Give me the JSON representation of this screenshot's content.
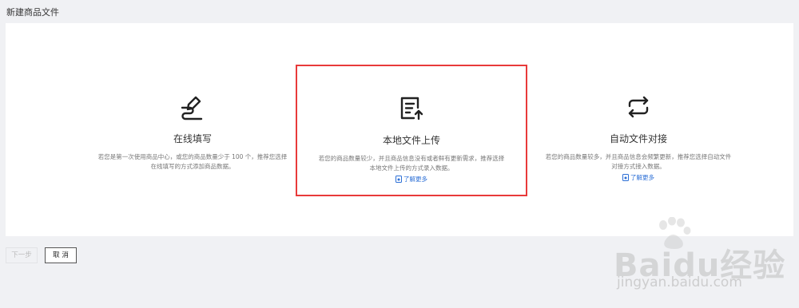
{
  "page_title": "新建商品文件",
  "options": [
    {
      "icon": "pen-write-icon",
      "title": "在线填写",
      "desc_line1": "若您是第一次使用商品中心，或您的商品数量少于 100 个，推荐您选择",
      "desc_line2": "在线填写的方式添加商品数据。",
      "learn_more": ""
    },
    {
      "icon": "file-upload-icon",
      "title": "本地文件上传",
      "desc_line1": "若您的商品数量较少，并且商品信息没有或者鲜有更新需求，推荐选择",
      "desc_line2": "本地文件上传的方式录入数据。",
      "learn_more": "了解更多"
    },
    {
      "icon": "sync-arrows-icon",
      "title": "自动文件对接",
      "desc_line1": "若您的商品数量较多，并且商品信息会频繁更新，推荐您选择自动文件",
      "desc_line2": "对接方式接入数据。",
      "learn_more": "了解更多"
    }
  ],
  "buttons": {
    "next": "下一步",
    "cancel": "取 消"
  },
  "watermark": {
    "brand": "Baidu经验",
    "url": "jingyan.baidu.com"
  },
  "colors": {
    "selected_border": "#e83a3a",
    "link": "#2c6fd6",
    "background": "#f0f1f4"
  }
}
